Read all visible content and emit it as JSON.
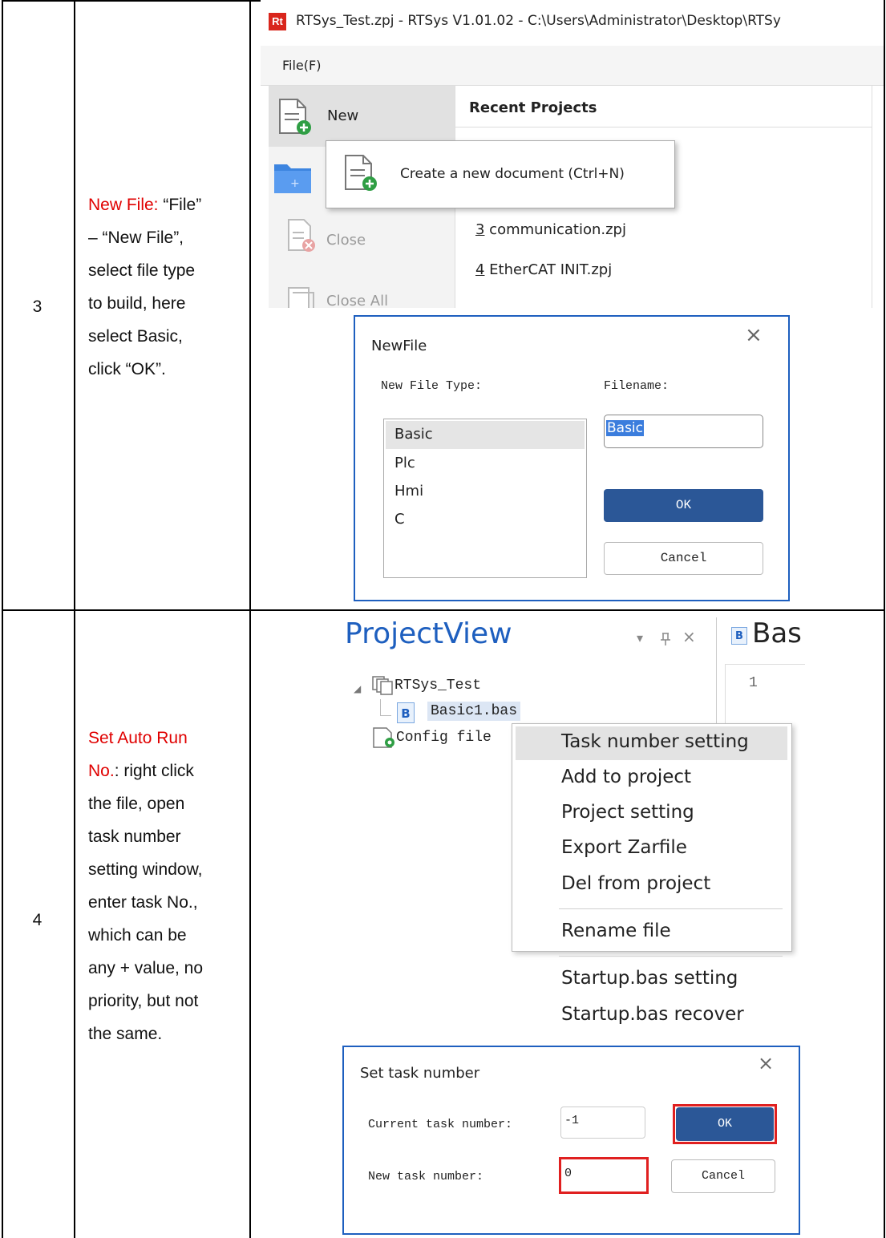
{
  "rows": [
    {
      "number": "3",
      "desc_highlight": "New File:",
      "desc_lines": [
        "New File: “File”",
        "– “New File”,",
        "select file type",
        "to build, here",
        "select Basic,",
        "click “OK”."
      ]
    },
    {
      "number": "4",
      "desc_highlight": "Set Auto Run No.:",
      "desc_lines": [
        "Set Auto Run",
        "No.: right click",
        "the file, open",
        "task number",
        "setting window,",
        "enter task No.,",
        "which can be",
        "any + value, no",
        "priority, but not",
        "the same."
      ]
    }
  ],
  "rtsys": {
    "app_icon": "Rt",
    "title": "RTSys_Test.zpj - RTSys V1.01.02 - C:\\Users\\Administrator\\Desktop\\RTSy",
    "menu_file": "File(F)",
    "side_new": "New",
    "side_close": "Close",
    "side_close_all": "Close All",
    "recent_header": "Recent Projects",
    "tooltip": "Create a new document (Ctrl+N)",
    "recent": [
      {
        "num": "3",
        "name": " communication.zpj"
      },
      {
        "num": "4",
        "name": " EtherCAT INIT.zpj"
      }
    ]
  },
  "newfile": {
    "title": "NewFile",
    "close": "×",
    "type_label": "New File Type:",
    "filename_label": "Filename:",
    "types": [
      "Basic",
      "Plc",
      "Hmi",
      "C"
    ],
    "filename_value": "Basic",
    "ok": "OK",
    "cancel": "Cancel"
  },
  "projectview": {
    "title": "ProjectView",
    "pin": "ᵖ",
    "dropdown": "▾",
    "close": "×",
    "tab_label": "Bas",
    "line_number": "1",
    "project": "RTSys_Test",
    "file": "Basic1.bas",
    "config": "Config file",
    "context_menu": [
      "Task number setting",
      "Add to project",
      "Project setting",
      "Export Zarfile",
      "Del from project",
      "Rename file",
      "Startup.bas setting",
      "Startup.bas recover"
    ]
  },
  "settask": {
    "title": "Set task number",
    "close": "×",
    "current_label": "Current task number:",
    "current_value": "-1",
    "new_label": "New task number:",
    "new_value": "0",
    "ok": "OK",
    "cancel": "Cancel"
  },
  "colors": {
    "highlight_red": "#e00000",
    "dialog_border": "#1e5fbf",
    "ok_blue": "#2b5797",
    "selection": "#3b7ddd",
    "folder_blue": "#3d85e0",
    "file_green": "#2f9e44"
  }
}
